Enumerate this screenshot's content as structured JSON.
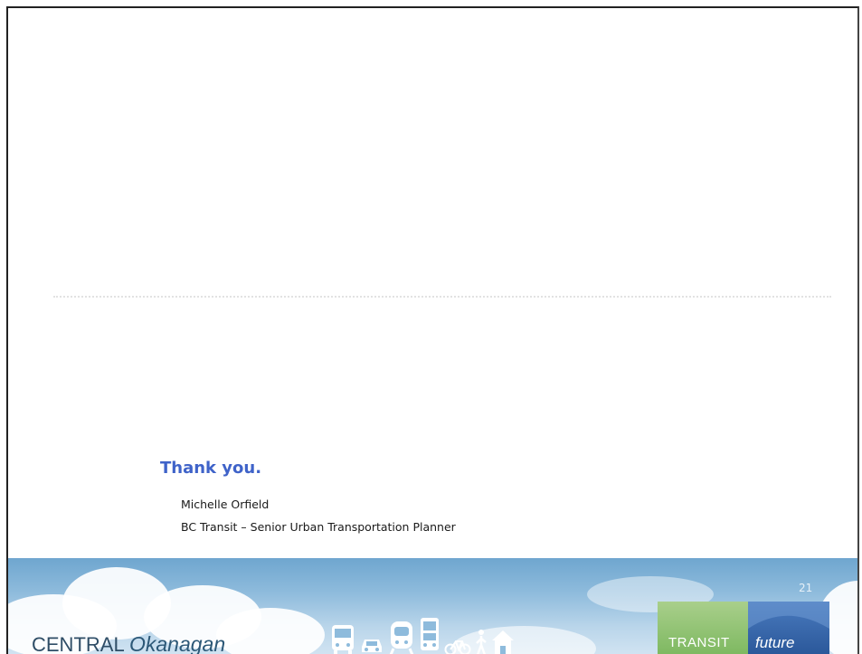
{
  "slide": {
    "closing_heading": "Thank you.",
    "presenter_name": "Michelle Orfield",
    "presenter_role": "BC Transit – Senior Urban Transportation Planner"
  },
  "footer": {
    "brand_prefix": "CENTRAL",
    "brand_region": "Okanagan",
    "logo_left": "TRANSIT",
    "logo_right": "future",
    "page_number": "21",
    "icons": [
      "bus-icon",
      "car-icon",
      "train-icon",
      "transit-icon",
      "bicycle-icon",
      "pedestrian-icon",
      "house-icon"
    ]
  },
  "colors": {
    "heading": "#3f63c9",
    "sky_top": "#6fa6cf",
    "sky_bottom": "#d2e4f2",
    "logo_green": "#7db860",
    "logo_blue": "#2a5799"
  }
}
